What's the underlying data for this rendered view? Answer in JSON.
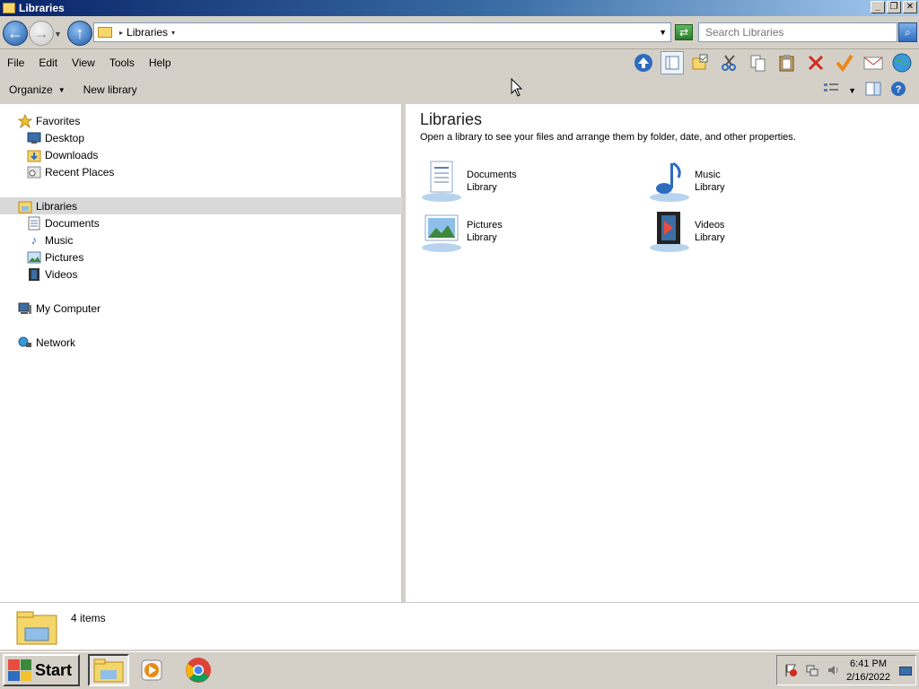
{
  "window": {
    "title": "Libraries"
  },
  "title_buttons": {
    "minimize": "_",
    "maximize": "❐",
    "close": "✕"
  },
  "address": {
    "crumb": "Libraries",
    "search_placeholder": "Search Libraries"
  },
  "menu": [
    "File",
    "Edit",
    "View",
    "Tools",
    "Help"
  ],
  "commands": {
    "organize": "Organize",
    "new_library": "New library"
  },
  "nav": {
    "favorites": {
      "label": "Favorites",
      "items": [
        "Desktop",
        "Downloads",
        "Recent Places"
      ]
    },
    "libraries": {
      "label": "Libraries",
      "items": [
        "Documents",
        "Music",
        "Pictures",
        "Videos"
      ]
    },
    "computer": "My Computer",
    "network": "Network"
  },
  "content": {
    "heading": "Libraries",
    "description": "Open a library to see your files and arrange them by folder, date, and other properties.",
    "libraries": [
      {
        "name": "Documents",
        "type": "Library",
        "icon": "documents-library-icon"
      },
      {
        "name": "Music",
        "type": "Library",
        "icon": "music-library-icon"
      },
      {
        "name": "Pictures",
        "type": "Library",
        "icon": "pictures-library-icon"
      },
      {
        "name": "Videos",
        "type": "Library",
        "icon": "videos-library-icon"
      }
    ]
  },
  "status": {
    "count": "4 items"
  },
  "taskbar": {
    "start": "Start",
    "time": "6:41 PM",
    "date": "2/16/2022"
  },
  "colors": {
    "title_gradient_start": "#0a246a",
    "title_gradient_end": "#a6caf0",
    "chrome": "#d4d0c8",
    "selection": "#d9d9d9"
  }
}
